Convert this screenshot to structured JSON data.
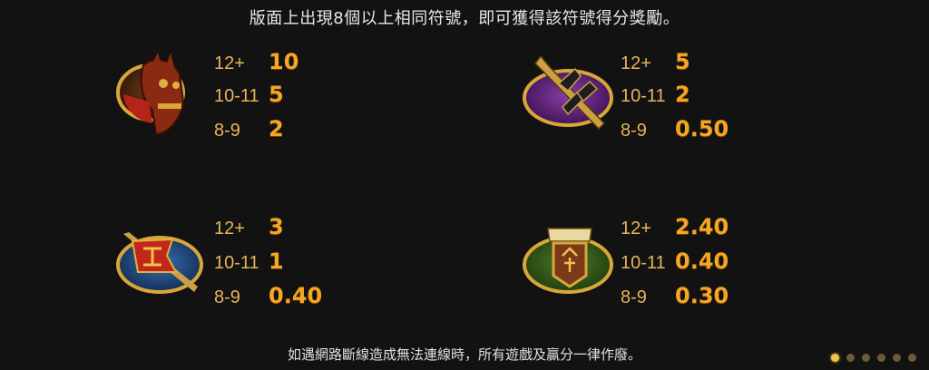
{
  "header": {
    "text": "版面上出現8個以上相同符號，即可獲得該符號得分獎勵。"
  },
  "footer": {
    "text": "如遇網路斷線造成無法連線時，所有遊戲及贏分一律作廢。"
  },
  "paytable": [
    {
      "symbol": "horse-icon",
      "rows": [
        {
          "count": "12+",
          "value": "10"
        },
        {
          "count": "10-11",
          "value": "5"
        },
        {
          "count": "8-9",
          "value": "2"
        }
      ]
    },
    {
      "symbol": "halberd-icon",
      "rows": [
        {
          "count": "12+",
          "value": "5"
        },
        {
          "count": "10-11",
          "value": "2"
        },
        {
          "count": "8-9",
          "value": "0.50"
        }
      ]
    },
    {
      "symbol": "war-flag-icon",
      "rows": [
        {
          "count": "12+",
          "value": "3"
        },
        {
          "count": "10-11",
          "value": "1"
        },
        {
          "count": "8-9",
          "value": "0.40"
        }
      ]
    },
    {
      "symbol": "army-seal-icon",
      "rows": [
        {
          "count": "12+",
          "value": "2.40"
        },
        {
          "count": "10-11",
          "value": "0.40"
        },
        {
          "count": "8-9",
          "value": "0.30"
        }
      ]
    }
  ],
  "pagination": {
    "total": 6,
    "active": 0
  },
  "colors": {
    "value": "#f5a623",
    "count": "#e7b45a",
    "background": "#121212"
  }
}
